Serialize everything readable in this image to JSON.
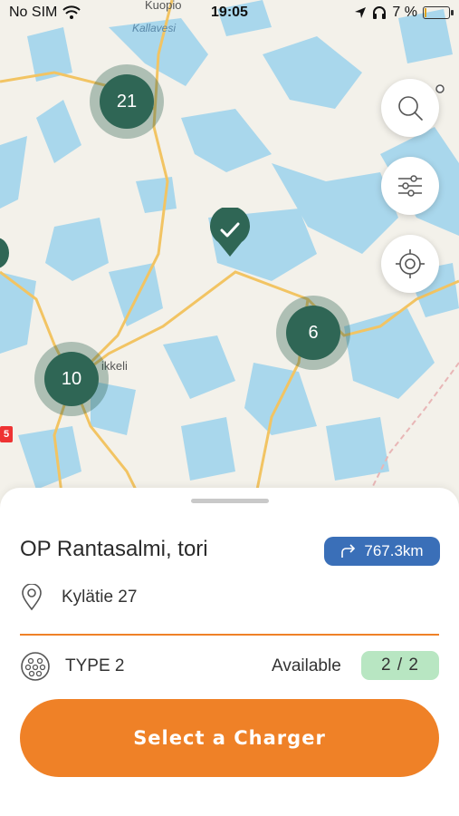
{
  "status_bar": {
    "carrier": "No SIM",
    "time": "19:05",
    "battery_percent": "7 %",
    "icons": [
      "wifi-icon",
      "location-arrow-icon",
      "headphones-icon",
      "battery-icon"
    ]
  },
  "map": {
    "labels": {
      "city_top": "Kuopio",
      "lake": "Kallavesi",
      "city_left": "ikkeli"
    },
    "clusters": [
      {
        "count": "21"
      },
      {
        "count": "6"
      },
      {
        "count": "10"
      }
    ],
    "road_badge": "5",
    "controls": [
      "search-icon",
      "filter-sliders-icon",
      "locate-crosshair-icon"
    ]
  },
  "station": {
    "name": "OP Rantasalmi, tori",
    "distance": "767.3km",
    "address": "Kylätie 27",
    "connector_type": "TYPE 2",
    "available_label": "Available",
    "available_value": "2 / 2"
  },
  "action": {
    "select_label": "Select a Charger"
  },
  "colors": {
    "accent_orange": "#ef8127",
    "cluster_green": "#2f6655",
    "distance_blue": "#3a6fb8",
    "available_green": "#b8e6c2",
    "water": "#a9d7ec",
    "road": "#f2c463"
  }
}
